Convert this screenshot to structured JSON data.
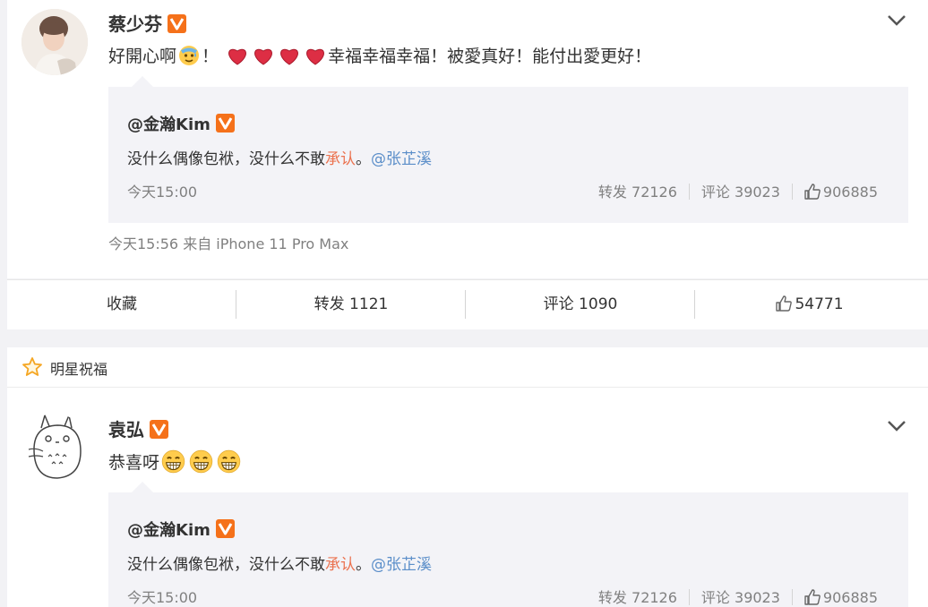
{
  "post1": {
    "author": "蔡少芬",
    "text_prefix": "好開心啊",
    "text_after_emoji": "！",
    "text_suffix": "幸福幸福幸福！被愛真好！能付出愛更好！",
    "meta": "今天15:56  来自 iPhone 11 Pro Max",
    "quote": {
      "author": "@金瀚Kim",
      "text_plain": "没什么偶像包袱，没什么不敢",
      "text_red": "承认",
      "text_punct": "。",
      "mention": "@张芷溪",
      "time": "今天15:00",
      "repost": "转发 72126",
      "comment": "评论 39023",
      "likes": "906885"
    }
  },
  "actions": {
    "favorite": "收藏",
    "repost": "转发 1121",
    "comment": "评论 1090",
    "likes": "54771"
  },
  "section": {
    "label": "明星祝福"
  },
  "post2": {
    "author": "袁弘",
    "text": "恭喜呀",
    "quote": {
      "author": "@金瀚Kim",
      "text_plain": "没什么偶像包袱，没什么不敢",
      "text_red": "承认",
      "text_punct": "。",
      "mention": "@张芷溪",
      "time": "今天15:00",
      "repost": "转发 72126",
      "comment": "评论 39023",
      "likes": "906885"
    }
  },
  "colors": {
    "accent": "#eb7350",
    "mention": "#5b8ec9",
    "quote_bg": "#f3f3f7",
    "verified": "#f5711a"
  },
  "icons": [
    "verified-badge-icon",
    "chevron-down-icon",
    "heart-icon",
    "grin-emoji-icon",
    "sweat-emoji-icon",
    "thumbs-up-icon",
    "star-icon"
  ]
}
